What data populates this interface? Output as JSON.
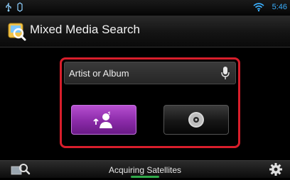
{
  "statusbar": {
    "time": "5:46",
    "icons": [
      "usb-icon",
      "sync-icon",
      "wifi-icon"
    ]
  },
  "titlebar": {
    "title": "Mixed Media Search",
    "icon": "app-search-icon"
  },
  "search": {
    "label": "Artist or Album",
    "mic_icon": "microphone-icon"
  },
  "buttons": {
    "artist_icon": "artist-icon",
    "album_icon": "album-disc-icon"
  },
  "bottombar": {
    "status": "Acquiring Satellites",
    "left_icon": "map-search-icon",
    "right_icon": "settings-gear-icon"
  },
  "colors": {
    "accent_blue": "#3bb0ff",
    "highlight_red": "#d81e2b",
    "artist_purple": "#9b37bb",
    "status_green": "#3ad15a"
  }
}
